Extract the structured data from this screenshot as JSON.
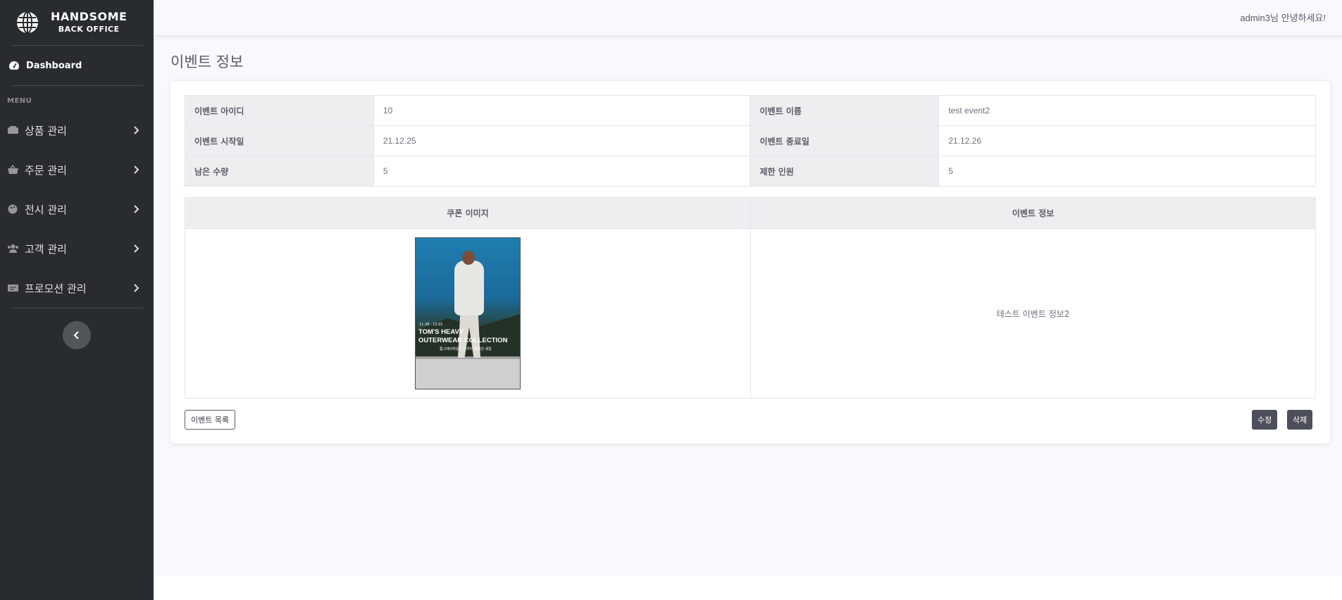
{
  "sidebar": {
    "brand_line1": "HANDSOME",
    "brand_line2": "BACK OFFICE",
    "brand_icon": "globe-icon",
    "dashboard_label": "Dashboard",
    "menu_heading": "MENU",
    "items": [
      {
        "label": "상품 관리",
        "icon": "product-icon"
      },
      {
        "label": "주문 관리",
        "icon": "basket-icon"
      },
      {
        "label": "전시 관리",
        "icon": "palette-icon"
      },
      {
        "label": "고객 관리",
        "icon": "users-icon"
      },
      {
        "label": "프로모션 관리",
        "icon": "ticket-icon"
      }
    ]
  },
  "topbar": {
    "greeting": "admin3님 안녕하세요!"
  },
  "page": {
    "title": "이벤트 정보"
  },
  "info": {
    "id_label": "이벤트 아이디",
    "id_value": "10",
    "name_label": "이벤트 이름",
    "name_value": "test event2",
    "start_label": "이벤트 시작일",
    "start_value": "21.12.25",
    "end_label": "이벤트 종료일",
    "end_value": "21.12.26",
    "remaining_label": "남은 수량",
    "remaining_value": "5",
    "limit_label": "제한 인원",
    "limit_value": "5"
  },
  "media": {
    "coupon_header": "쿠폰 이미지",
    "info_header": "이벤트 정보",
    "description": "테스트 이벤트 정보2",
    "poster": {
      "dates": "11.28 - 12.01",
      "title_line1": "TOM'S HEAVY",
      "title_line2": "OUTERWEAR COLLECTION",
      "subtitle": "톰그레이하운드 아우터 컬렉션 세일"
    }
  },
  "buttons": {
    "list": "이벤트 목록",
    "edit": "수정",
    "delete": "삭제"
  },
  "colors": {
    "sidebar_bg": "#292c2f",
    "page_bg": "#f8f9fc",
    "header_cell_bg": "#eceeef",
    "dark_button": "#4e4f5c"
  }
}
